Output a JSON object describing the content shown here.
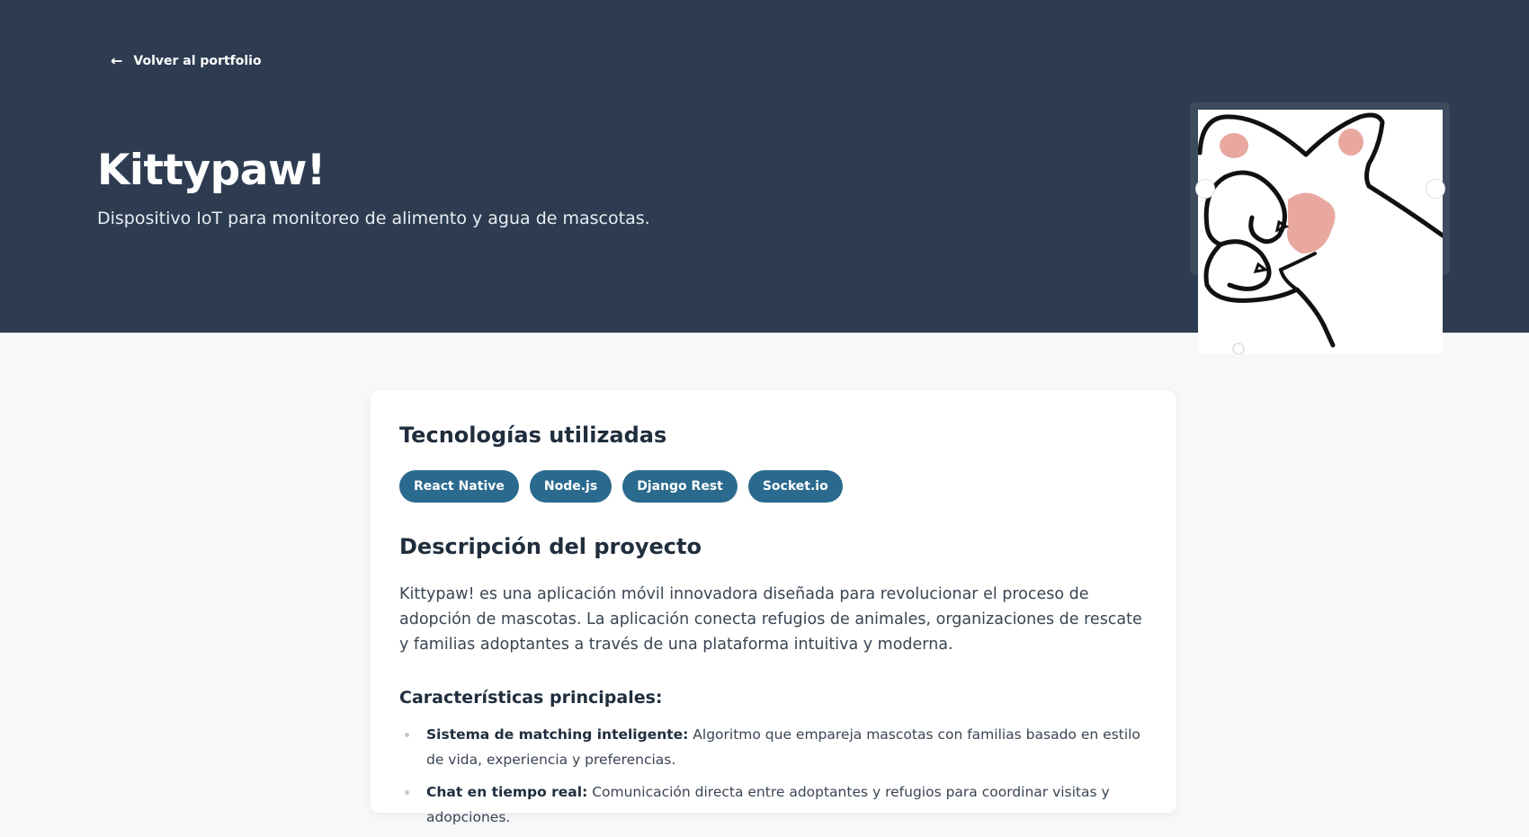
{
  "header": {
    "back_label": "Volver al portfolio",
    "back_icon": "arrow-left-icon",
    "title": "Kittypaw!",
    "subtitle": "Dispositivo IoT para monitoreo de alimento y agua de mascotas."
  },
  "carousel": {
    "image_description": "cat-paw-illustration"
  },
  "technologies": {
    "title": "Tecnologías utilizadas",
    "tags": [
      "React Native",
      "Node.js",
      "Django Rest",
      "Socket.io"
    ]
  },
  "description": {
    "title": "Descripción del proyecto",
    "text": "Kittypaw! es una aplicación móvil innovadora diseñada para revolucionar el proceso de adopción de mascotas. La aplicación conecta refugios de animales, organizaciones de rescate y familias adoptantes a través de una plataforma intuitiva y moderna."
  },
  "features": {
    "title": "Características principales:",
    "items": [
      {
        "label": "Sistema de matching inteligente:",
        "text": " Algoritmo que empareja mascotas con familias basado en estilo de vida, experiencia y preferencias."
      },
      {
        "label": "Chat en tiempo real:",
        "text": " Comunicación directa entre adoptantes y refugios para coordinar visitas y adopciones."
      }
    ]
  },
  "colors": {
    "hero_bg": "#2d3c50",
    "tag_bg": "#2a6a8e",
    "page_bg": "#f7f8fa",
    "paw_pad": "#e8a8a0"
  }
}
